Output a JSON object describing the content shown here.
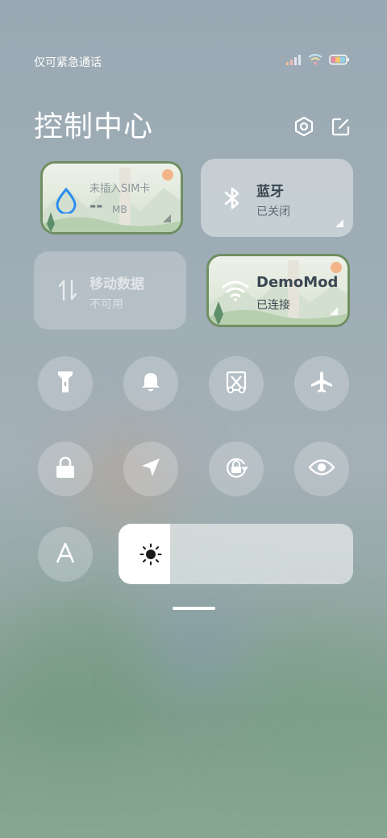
{
  "status_bar": {
    "carrier": "仅可紧急通话",
    "icons": [
      "signal-icon",
      "wifi-icon",
      "battery-icon"
    ]
  },
  "header": {
    "title": "控制中心",
    "settings_icon": "settings-icon",
    "edit_icon": "edit-icon"
  },
  "tiles": {
    "data_usage": {
      "label": "未插入SIM卡",
      "value": "--",
      "unit": "MB",
      "icon": "water-drop-icon"
    },
    "bluetooth": {
      "label": "蓝牙",
      "status": "已关闭",
      "icon": "bluetooth-icon"
    },
    "mobile_data": {
      "label": "移动数据",
      "status": "不可用",
      "icon": "data-arrows-icon"
    },
    "wifi": {
      "label": "DemoMod",
      "status": "已连接",
      "icon": "wifi-icon"
    }
  },
  "toggles_row1": [
    "flashlight-icon",
    "bell-icon",
    "screenshot-icon",
    "airplane-icon"
  ],
  "toggles_row2": [
    "lock-icon",
    "location-icon",
    "rotation-lock-icon",
    "eye-icon"
  ],
  "auto_brightness_icon": "font-a-icon",
  "brightness": {
    "icon": "sun-icon",
    "level": 0.22
  },
  "colors": {
    "accent_blue": "#2b8ef0",
    "scene_border": "#6f8f62",
    "text_dark": "#3a4752"
  }
}
